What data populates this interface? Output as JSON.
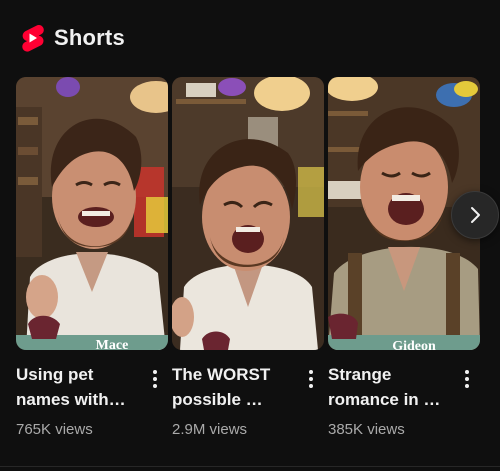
{
  "section": {
    "title": "Shorts",
    "logo_icon": "youtube-shorts-icon",
    "accent_color": "#ff0033"
  },
  "cards": [
    {
      "title": "Using pet\nnames with…",
      "views": "765K views",
      "banner_text": "Mace",
      "menu_icon": "more-vertical-icon"
    },
    {
      "title": "The WORST\npossible …",
      "views": "2.9M views",
      "banner_text": "",
      "menu_icon": "more-vertical-icon"
    },
    {
      "title": "Strange\nromance in …",
      "views": "385K views",
      "banner_text": "Gideon",
      "menu_icon": "more-vertical-icon"
    }
  ],
  "navigation": {
    "next_icon": "chevron-right-icon"
  }
}
